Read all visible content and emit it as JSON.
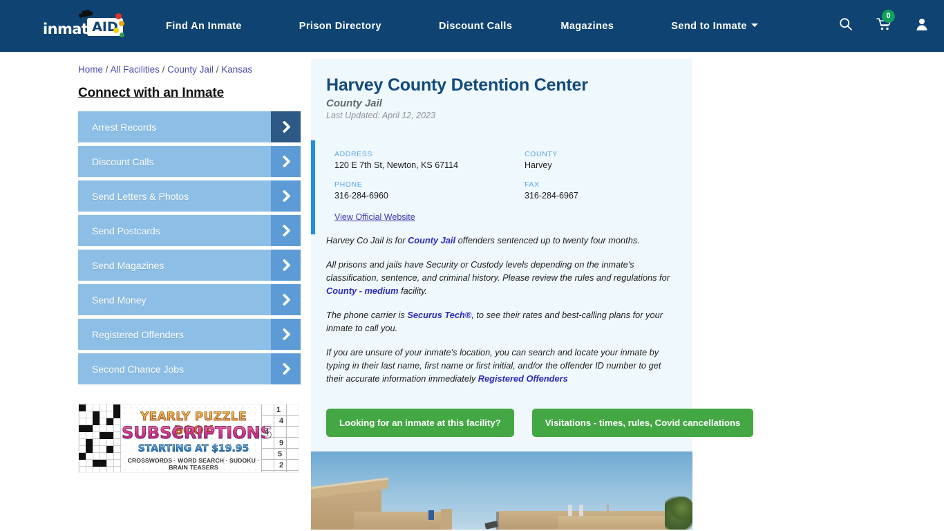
{
  "nav": {
    "logo_text": "inmate",
    "logo_badge": "AID",
    "links": [
      {
        "label": "Find An Inmate"
      },
      {
        "label": "Prison Directory"
      },
      {
        "label": "Discount Calls"
      },
      {
        "label": "Magazines"
      },
      {
        "label": "Send to Inmate"
      }
    ],
    "cart_count": "0",
    "icons": [
      "search-icon",
      "cart-icon",
      "user-icon"
    ],
    "bar_color": "#0e4372"
  },
  "breadcrumb": {
    "items": [
      "Home",
      "All Facilities",
      "County Jail",
      "Kansas"
    ],
    "separator": "/"
  },
  "sidebar": {
    "title": "Connect with an Inmate",
    "items": [
      {
        "label": "Arrest Records"
      },
      {
        "label": "Discount Calls"
      },
      {
        "label": "Send Letters & Photos"
      },
      {
        "label": "Send Postcards"
      },
      {
        "label": "Send Magazines"
      },
      {
        "label": "Send Money"
      },
      {
        "label": "Registered Offenders"
      },
      {
        "label": "Second Chance Jobs"
      }
    ],
    "item_color": "#8dbfe6",
    "arrow_color": "#5c9bd6",
    "arrow_active_color": "#2d5986"
  },
  "ad": {
    "line1": "YEARLY PUZZLE BOOK",
    "line2": "SUBSCRIPTIONS",
    "line3": "STARTING AT $19.95",
    "line4": "CROSSWORDS · WORD SEARCH · SUDOKU · BRAIN TEASERS",
    "sudoku_digits": [
      "1",
      "4",
      "4",
      "9",
      "5",
      "2"
    ]
  },
  "facility": {
    "name": "Harvey County Detention Center",
    "type": "County Jail",
    "last_updated": "Last Updated: April 12, 2023",
    "info": {
      "address_label": "ADDRESS",
      "address_value": "120 E 7th St, Newton, KS 67114",
      "county_label": "COUNTY",
      "county_value": "Harvey",
      "phone_label": "PHONE",
      "phone_value": "316-284-6960",
      "fax_label": "FAX",
      "fax_value": "316-284-6967",
      "website_link": "View Official Website"
    },
    "accent_color": "#1d8fe8",
    "card_bg": "#eff8fd"
  },
  "body": {
    "p1_a": "Harvey Co Jail is for ",
    "p1_link": "County Jail",
    "p1_b": " offenders sentenced up to twenty four months.",
    "p2_a": "All prisons and jails have Security or Custody levels depending on the inmate's classification, sentence, and criminal history. Please review the rules and regulations for ",
    "p2_link": "County - medium",
    "p2_b": " facility.",
    "p3_a": "The phone carrier is ",
    "p3_link": "Securus Tech®",
    "p3_b": ", to see their rates and best-calling plans for your inmate to call you.",
    "p4_a": "If you are unsure of your inmate's location, you can search and locate your inmate by typing in their last name, first name or first initial, and/or the offender ID number to get their accurate information immediately ",
    "p4_link": "Registered Offenders"
  },
  "buttons": {
    "inmate_search": "Looking for an inmate at this facility?",
    "visitations": "Visitations - times, rules, Covid cancellations",
    "color": "#43a843"
  },
  "photo": {
    "caption": "Exterior photo of the Harvey County Detention Center building under blue sky"
  }
}
